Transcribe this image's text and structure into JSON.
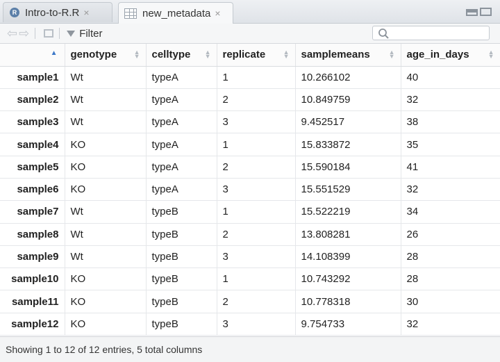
{
  "tabs": [
    {
      "label": "Intro-to-R.R",
      "icon": "r-script-icon"
    },
    {
      "label": "new_metadata",
      "icon": "data-grid-icon"
    }
  ],
  "tab_close_glyph": "×",
  "toolbar": {
    "filter_label": "Filter"
  },
  "table": {
    "columns": [
      "",
      "genotype",
      "celltype",
      "replicate",
      "samplemeans",
      "age_in_days"
    ],
    "rows": [
      [
        "sample1",
        "Wt",
        "typeA",
        "1",
        "10.266102",
        "40"
      ],
      [
        "sample2",
        "Wt",
        "typeA",
        "2",
        "10.849759",
        "32"
      ],
      [
        "sample3",
        "Wt",
        "typeA",
        "3",
        "9.452517",
        "38"
      ],
      [
        "sample4",
        "KO",
        "typeA",
        "1",
        "15.833872",
        "35"
      ],
      [
        "sample5",
        "KO",
        "typeA",
        "2",
        "15.590184",
        "41"
      ],
      [
        "sample6",
        "KO",
        "typeA",
        "3",
        "15.551529",
        "32"
      ],
      [
        "sample7",
        "Wt",
        "typeB",
        "1",
        "15.522219",
        "34"
      ],
      [
        "sample8",
        "Wt",
        "typeB",
        "2",
        "13.808281",
        "26"
      ],
      [
        "sample9",
        "Wt",
        "typeB",
        "3",
        "14.108399",
        "28"
      ],
      [
        "sample10",
        "KO",
        "typeB",
        "1",
        "10.743292",
        "28"
      ],
      [
        "sample11",
        "KO",
        "typeB",
        "2",
        "10.778318",
        "30"
      ],
      [
        "sample12",
        "KO",
        "typeB",
        "3",
        "9.754733",
        "32"
      ]
    ]
  },
  "footer": {
    "status": "Showing 1 to 12 of 12 entries, 5 total columns"
  }
}
